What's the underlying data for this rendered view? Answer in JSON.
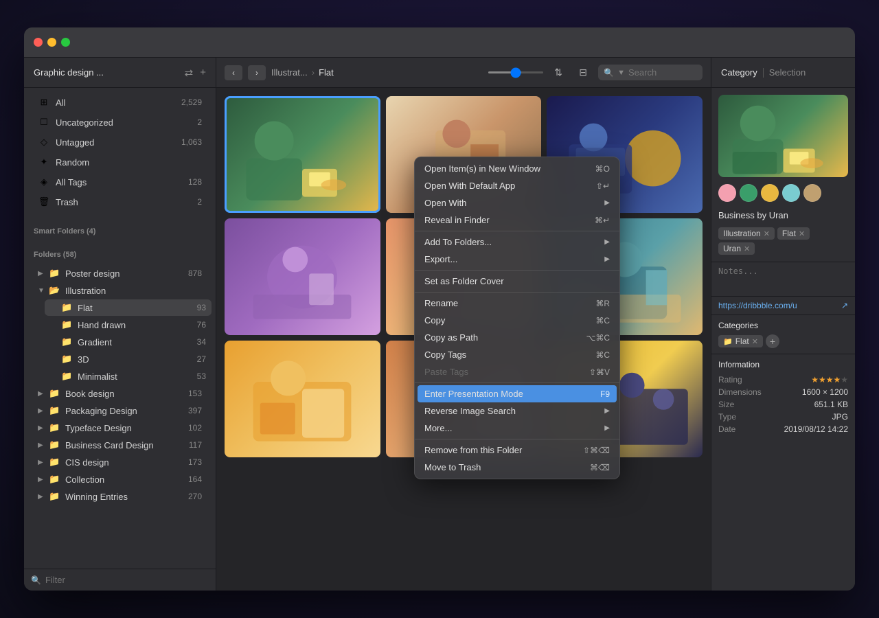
{
  "window": {
    "title": "Graphic design ...",
    "sidebar": {
      "title": "Graphic design ...",
      "smart_folders_label": "Smart Folders (4)",
      "folders_label": "Folders (58)",
      "items": [
        {
          "label": "All",
          "count": "2,529",
          "icon": "⊞"
        },
        {
          "label": "Uncategorized",
          "count": "2",
          "icon": "☐"
        },
        {
          "label": "Untagged",
          "count": "1,063",
          "icon": "◇"
        },
        {
          "label": "Random",
          "count": "",
          "icon": "✦"
        },
        {
          "label": "All Tags",
          "count": "128",
          "icon": "◈"
        },
        {
          "label": "Trash",
          "count": "2",
          "icon": "🗑"
        }
      ],
      "folders": [
        {
          "label": "Poster design",
          "count": "878",
          "expanded": false
        },
        {
          "label": "Illustration",
          "count": "",
          "expanded": true,
          "children": [
            {
              "label": "Flat",
              "count": "93",
              "active": true
            },
            {
              "label": "Hand drawn",
              "count": "76"
            },
            {
              "label": "Gradient",
              "count": "34"
            },
            {
              "label": "3D",
              "count": "27"
            },
            {
              "label": "Minimalist",
              "count": "53"
            }
          ]
        },
        {
          "label": "Book design",
          "count": "153",
          "expanded": false
        },
        {
          "label": "Packaging Design",
          "count": "397",
          "expanded": false
        },
        {
          "label": "Typeface Design",
          "count": "102",
          "expanded": false
        },
        {
          "label": "Business Card Design",
          "count": "117",
          "expanded": false
        },
        {
          "label": "CIS design",
          "count": "173",
          "expanded": false
        },
        {
          "label": "Collection",
          "count": "164",
          "expanded": false
        },
        {
          "label": "Winning Entries",
          "count": "270",
          "expanded": false
        }
      ],
      "filter_placeholder": "Filter"
    },
    "toolbar": {
      "breadcrumb_parent": "Illustrat...",
      "breadcrumb_current": "Flat",
      "search_placeholder": "Search"
    },
    "context_menu": {
      "items": [
        {
          "label": "Open Item(s) in New Window",
          "shortcut": "⌘O",
          "has_arrow": false
        },
        {
          "label": "Open With Default App",
          "shortcut": "⇧↵",
          "has_arrow": false
        },
        {
          "label": "Open With",
          "shortcut": "",
          "has_arrow": true
        },
        {
          "label": "Reveal in Finder",
          "shortcut": "⌘↵",
          "has_arrow": false
        },
        {
          "separator": true
        },
        {
          "label": "Add To Folders...",
          "shortcut": "",
          "has_arrow": true
        },
        {
          "label": "Export...",
          "shortcut": "",
          "has_arrow": true
        },
        {
          "separator": true
        },
        {
          "label": "Set as Folder Cover",
          "shortcut": "",
          "has_arrow": false
        },
        {
          "separator": true
        },
        {
          "label": "Rename",
          "shortcut": "⌘R",
          "has_arrow": false
        },
        {
          "label": "Copy",
          "shortcut": "⌘C",
          "has_arrow": false
        },
        {
          "label": "Copy as Path",
          "shortcut": "⌥⌘C",
          "has_arrow": false
        },
        {
          "label": "Copy Tags",
          "shortcut": "⌘C",
          "has_arrow": false
        },
        {
          "label": "Paste Tags",
          "shortcut": "⇧⌘V",
          "disabled": true,
          "has_arrow": false
        },
        {
          "separator": true
        },
        {
          "label": "Enter Presentation Mode",
          "shortcut": "F9",
          "highlighted": true,
          "has_arrow": false
        },
        {
          "label": "Reverse Image Search",
          "shortcut": "",
          "has_arrow": true
        },
        {
          "label": "More...",
          "shortcut": "",
          "has_arrow": true
        },
        {
          "separator": true
        },
        {
          "label": "Remove from this Folder",
          "shortcut": "⇧⌘⌫",
          "has_arrow": false
        },
        {
          "label": "Move to Trash",
          "shortcut": "⌘⌫",
          "has_arrow": false
        }
      ]
    },
    "right_panel": {
      "tab_category": "Category",
      "tab_selection": "Selection",
      "artist": "Business by Uran",
      "tags": [
        {
          "label": "Illustration"
        },
        {
          "label": "Flat"
        },
        {
          "label": "Uran"
        }
      ],
      "notes_placeholder": "Notes...",
      "url": "https://dribbble.com/u",
      "categories_label": "Categories",
      "category_tag": "Flat",
      "information_label": "Information",
      "rating": "★★★★",
      "dimensions": "1600 × 1200",
      "size": "651.1 KB",
      "type": "JPG",
      "date": "2019/08/12  14:22",
      "swatches": [
        "#f4a0b0",
        "#3a9e6a",
        "#e8b840",
        "#7accd0",
        "#c0a070"
      ]
    }
  }
}
